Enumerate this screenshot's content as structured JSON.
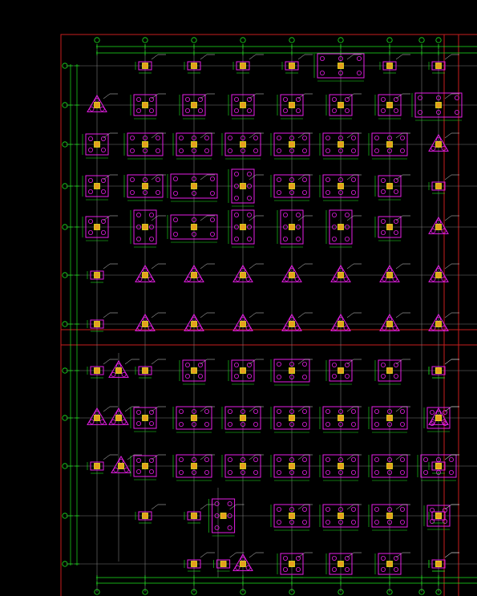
{
  "drawing": {
    "type": "CAD foundation pile-cap layout plan",
    "background": "#000000",
    "colors": {
      "frame": "#c81e1e",
      "grid": "#7a7a7a",
      "dimension": "#1ee61e",
      "cap": "#e61ee6",
      "column": "#e6e61e",
      "column_fill": "#e6a01e",
      "label": "#d8d8d8"
    },
    "grid_columns": 9,
    "grid_rows": 12,
    "block_count": 2,
    "pile_caps": [
      {
        "row": 1,
        "col": 1,
        "kind": "small"
      },
      {
        "row": 1,
        "col": 2,
        "kind": "small"
      },
      {
        "row": 1,
        "col": 3,
        "kind": "small"
      },
      {
        "row": 1,
        "col": 4,
        "kind": "small"
      },
      {
        "row": 1,
        "col": 5,
        "kind": "wide"
      },
      {
        "row": 1,
        "col": 6,
        "kind": "small"
      },
      {
        "row": 1,
        "col": 8,
        "kind": "small"
      },
      {
        "row": 2,
        "col": 0,
        "kind": "tri"
      },
      {
        "row": 2,
        "col": 1,
        "kind": "square"
      },
      {
        "row": 2,
        "col": 2,
        "kind": "square"
      },
      {
        "row": 2,
        "col": 3,
        "kind": "square"
      },
      {
        "row": 2,
        "col": 4,
        "kind": "square"
      },
      {
        "row": 2,
        "col": 5,
        "kind": "square"
      },
      {
        "row": 2,
        "col": 6,
        "kind": "square"
      },
      {
        "row": 2,
        "col": 8,
        "kind": "wide"
      },
      {
        "row": 3,
        "col": 0,
        "kind": "square"
      },
      {
        "row": 3,
        "col": 1,
        "kind": "rect"
      },
      {
        "row": 3,
        "col": 2,
        "kind": "rect"
      },
      {
        "row": 3,
        "col": 3,
        "kind": "rect"
      },
      {
        "row": 3,
        "col": 4,
        "kind": "rect"
      },
      {
        "row": 3,
        "col": 5,
        "kind": "rect"
      },
      {
        "row": 3,
        "col": 6,
        "kind": "rect"
      },
      {
        "row": 3,
        "col": 8,
        "kind": "tri"
      },
      {
        "row": 4,
        "col": 0,
        "kind": "square"
      },
      {
        "row": 4,
        "col": 1,
        "kind": "rect"
      },
      {
        "row": 4,
        "col": 2,
        "kind": "wide"
      },
      {
        "row": 4,
        "col": 3,
        "kind": "tall"
      },
      {
        "row": 4,
        "col": 4,
        "kind": "rect"
      },
      {
        "row": 4,
        "col": 5,
        "kind": "rect"
      },
      {
        "row": 4,
        "col": 6,
        "kind": "square"
      },
      {
        "row": 4,
        "col": 8,
        "kind": "small"
      },
      {
        "row": 5,
        "col": 0,
        "kind": "square"
      },
      {
        "row": 5,
        "col": 1,
        "kind": "tall"
      },
      {
        "row": 5,
        "col": 2,
        "kind": "wide"
      },
      {
        "row": 5,
        "col": 3,
        "kind": "tall"
      },
      {
        "row": 5,
        "col": 4,
        "kind": "tall"
      },
      {
        "row": 5,
        "col": 5,
        "kind": "tall"
      },
      {
        "row": 5,
        "col": 6,
        "kind": "square"
      },
      {
        "row": 5,
        "col": 8,
        "kind": "tri"
      },
      {
        "row": 6,
        "col": 0,
        "kind": "small"
      },
      {
        "row": 6,
        "col": 1,
        "kind": "tri"
      },
      {
        "row": 6,
        "col": 2,
        "kind": "tri"
      },
      {
        "row": 6,
        "col": 3,
        "kind": "tri"
      },
      {
        "row": 6,
        "col": 4,
        "kind": "tri"
      },
      {
        "row": 6,
        "col": 5,
        "kind": "tri"
      },
      {
        "row": 6,
        "col": 6,
        "kind": "tri"
      },
      {
        "row": 6,
        "col": 8,
        "kind": "tri"
      },
      {
        "row": 7,
        "col": 0,
        "kind": "small"
      },
      {
        "row": 7,
        "col": 1,
        "kind": "tri"
      },
      {
        "row": 7,
        "col": 2,
        "kind": "tri"
      },
      {
        "row": 7,
        "col": 3,
        "kind": "tri"
      },
      {
        "row": 7,
        "col": 4,
        "kind": "tri"
      },
      {
        "row": 7,
        "col": 5,
        "kind": "tri"
      },
      {
        "row": 7,
        "col": 6,
        "kind": "tri"
      },
      {
        "row": 7,
        "col": 8,
        "kind": "tri"
      },
      {
        "row": 8,
        "col": 0,
        "kind": "small"
      },
      {
        "row": 8,
        "col": 0.45,
        "kind": "tri"
      },
      {
        "row": 8,
        "col": 1,
        "kind": "small"
      },
      {
        "row": 8,
        "col": 2,
        "kind": "square"
      },
      {
        "row": 8,
        "col": 3,
        "kind": "square"
      },
      {
        "row": 8,
        "col": 4,
        "kind": "rect"
      },
      {
        "row": 8,
        "col": 5,
        "kind": "square"
      },
      {
        "row": 8,
        "col": 6,
        "kind": "square"
      },
      {
        "row": 8,
        "col": 8,
        "kind": "small"
      },
      {
        "row": 8,
        "col": 8.55,
        "kind": "small"
      },
      {
        "row": 9,
        "col": 0,
        "kind": "tri"
      },
      {
        "row": 9,
        "col": 0.45,
        "kind": "tri"
      },
      {
        "row": 9,
        "col": 1,
        "kind": "square"
      },
      {
        "row": 9,
        "col": 2,
        "kind": "rect"
      },
      {
        "row": 9,
        "col": 3,
        "kind": "rect"
      },
      {
        "row": 9,
        "col": 4,
        "kind": "rect"
      },
      {
        "row": 9,
        "col": 5,
        "kind": "rect"
      },
      {
        "row": 9,
        "col": 6,
        "kind": "rect"
      },
      {
        "row": 9,
        "col": 8,
        "kind": "square"
      },
      {
        "row": 9,
        "col": 8.55,
        "kind": "tri"
      },
      {
        "row": 10,
        "col": 0,
        "kind": "small"
      },
      {
        "row": 10,
        "col": 0.5,
        "kind": "tri"
      },
      {
        "row": 10,
        "col": 1,
        "kind": "square"
      },
      {
        "row": 10,
        "col": 2,
        "kind": "rect"
      },
      {
        "row": 10,
        "col": 3,
        "kind": "rect"
      },
      {
        "row": 10,
        "col": 4,
        "kind": "rect"
      },
      {
        "row": 10,
        "col": 5,
        "kind": "rect"
      },
      {
        "row": 10,
        "col": 6,
        "kind": "rect"
      },
      {
        "row": 10,
        "col": 8,
        "kind": "rect"
      },
      {
        "row": 10,
        "col": 8.55,
        "kind": "small"
      },
      {
        "row": 11,
        "col": 1,
        "kind": "small"
      },
      {
        "row": 11,
        "col": 2,
        "kind": "small"
      },
      {
        "row": 11,
        "col": 2.6,
        "kind": "tall"
      },
      {
        "row": 11,
        "col": 4,
        "kind": "rect"
      },
      {
        "row": 11,
        "col": 5,
        "kind": "rect"
      },
      {
        "row": 11,
        "col": 6,
        "kind": "rect"
      },
      {
        "row": 11,
        "col": 8,
        "kind": "square"
      },
      {
        "row": 11,
        "col": 8.55,
        "kind": "small"
      },
      {
        "row": 12,
        "col": 2,
        "kind": "small"
      },
      {
        "row": 12,
        "col": 2.6,
        "kind": "small"
      },
      {
        "row": 12,
        "col": 3,
        "kind": "tri"
      },
      {
        "row": 12,
        "col": 4,
        "kind": "square"
      },
      {
        "row": 12,
        "col": 5,
        "kind": "square"
      },
      {
        "row": 12,
        "col": 6,
        "kind": "square"
      },
      {
        "row": 12,
        "col": 8,
        "kind": "small"
      },
      {
        "row": 12,
        "col": 8.55,
        "kind": "small"
      }
    ]
  }
}
